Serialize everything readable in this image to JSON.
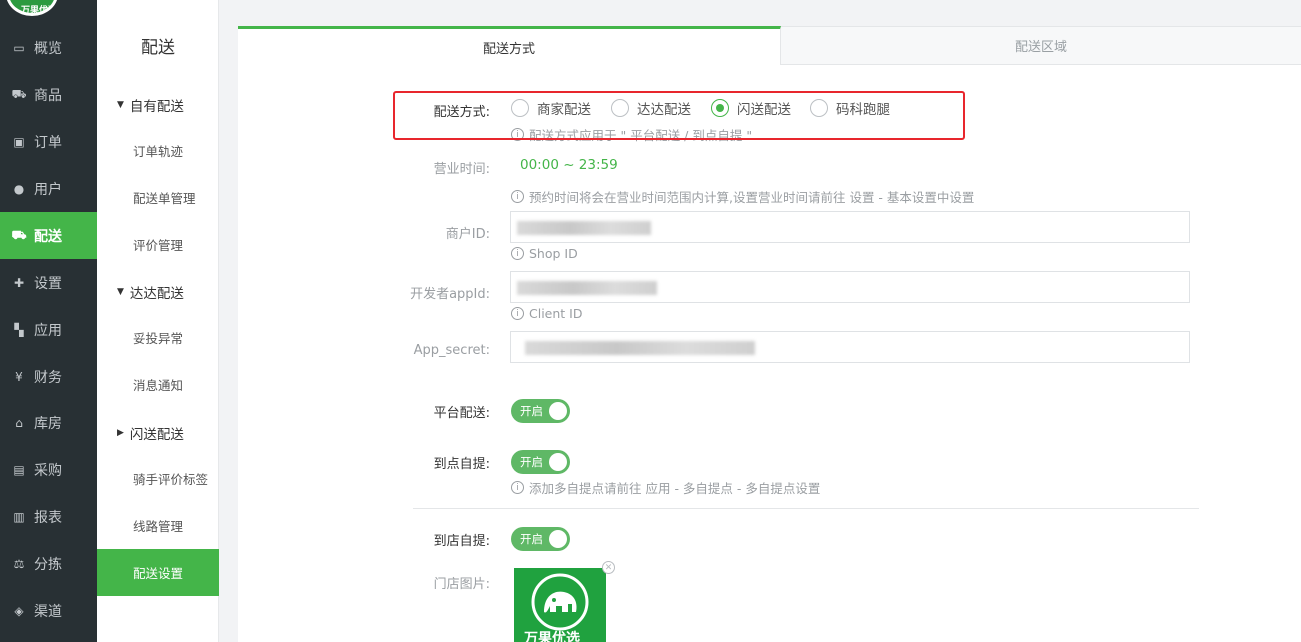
{
  "logo": {
    "text": "万果优选"
  },
  "nav": {
    "items": [
      {
        "label": "概览",
        "icon": "monitor-icon",
        "glyph": "▭"
      },
      {
        "label": "商品",
        "icon": "cart-icon",
        "glyph": "⛟"
      },
      {
        "label": "订单",
        "icon": "order-icon",
        "glyph": "▣"
      },
      {
        "label": "用户",
        "icon": "users-icon",
        "glyph": "●"
      },
      {
        "label": "配送",
        "icon": "truck-icon",
        "glyph": "⛟",
        "active": true
      },
      {
        "label": "设置",
        "icon": "puzzle-icon",
        "glyph": "✚"
      },
      {
        "label": "应用",
        "icon": "apps-icon",
        "glyph": "▚"
      },
      {
        "label": "财务",
        "icon": "yen-icon",
        "glyph": "¥"
      },
      {
        "label": "库房",
        "icon": "home-icon",
        "glyph": "⌂"
      },
      {
        "label": "采购",
        "icon": "purchase-icon",
        "glyph": "▤"
      },
      {
        "label": "报表",
        "icon": "bar-chart-icon",
        "glyph": "▥"
      },
      {
        "label": "分拣",
        "icon": "scale-icon",
        "glyph": "⚖"
      },
      {
        "label": "渠道",
        "icon": "cube-icon",
        "glyph": "◈"
      }
    ]
  },
  "submenu": {
    "title": "配送",
    "groups": [
      {
        "label": "自有配送",
        "tri": "▼"
      },
      {
        "label": "达达配送",
        "tri": "▼"
      },
      {
        "label": "闪送配送",
        "tri": "▶"
      }
    ],
    "items": {
      "order_track": "订单轨迹",
      "delivery_mgmt": "配送单管理",
      "review_mgmt": "评价管理",
      "complaint": "妥投异常",
      "message": "消息通知",
      "rider_tags": "骑手评价标签",
      "route_mgmt": "线路管理",
      "delivery_settings": "配送设置"
    }
  },
  "tabs": {
    "method": "配送方式",
    "area": "配送区域"
  },
  "form": {
    "method_label": "配送方式:",
    "methods": [
      {
        "label": "商家配送",
        "checked": false
      },
      {
        "label": "达达配送",
        "checked": false
      },
      {
        "label": "闪送配送",
        "checked": true
      },
      {
        "label": "码科跑腿",
        "checked": false
      }
    ],
    "method_hint": "配送方式应用于 \" 平台配送 / 到点自提 \"",
    "hours_label": "营业时间:",
    "hours_value": "00:00 ~ 23:59",
    "hours_hint": "预约时间将会在营业时间范围内计算,设置营业时间请前往 设置 - 基本设置中设置",
    "merchant_label": "商户ID:",
    "merchant_hint": "Shop ID",
    "appid_label": "开发者appId:",
    "appid_hint": "Client ID",
    "secret_label": "App_secret:",
    "platform_label": "平台配送:",
    "pickup_label": "到点自提:",
    "pickup_hint": "添加多自提点请前往 应用 - 多自提点 - 多自提点设置",
    "store_pickup_label": "到店自提:",
    "store_image_label": "门店图片:",
    "toggle_on": "开启",
    "store_logo_text": "万果优选",
    "info_glyph": "i",
    "close_glyph": "✕"
  },
  "colors": {
    "accent": "#44b549",
    "nav_bg": "#283034",
    "highlight": "#e8262d",
    "hours": "#44b549"
  }
}
